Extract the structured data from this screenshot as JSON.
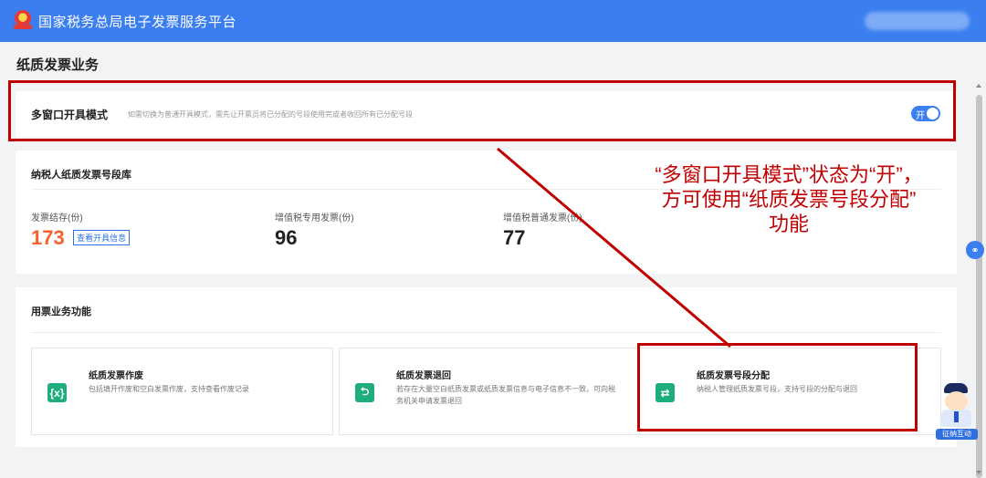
{
  "header": {
    "platform_name": "国家税务总局电子发票服务平台",
    "emblem_icon": "tax-emblem-icon",
    "brand_color": "#3a7ef0"
  },
  "page": {
    "title": "纸质发票业务"
  },
  "multi_window": {
    "title": "多窗口开具模式",
    "hint": "如需切换为普通开具模式，需先让开票员将已分配的号段使用完或者收回所有已分配号段",
    "toggle_label": "开",
    "toggle_on": true
  },
  "invoice_pool": {
    "title": "纳税人纸质发票号段库",
    "stats": [
      {
        "label": "发票结存(份)",
        "value": "173",
        "link": "查看开具信息"
      },
      {
        "label": "增值税专用发票(份)",
        "value": "96"
      },
      {
        "label": "增值税普通发票(份)",
        "value": "77"
      }
    ]
  },
  "functions": {
    "title": "用票业务功能",
    "tiles": [
      {
        "icon": "void-invoice-icon",
        "glyph": "{x}",
        "name": "纸质发票作废",
        "desc": "包括填开作废和空白发票作废，支持查看作废记录"
      },
      {
        "icon": "return-invoice-icon",
        "glyph": "⮌",
        "name": "纸质发票退回",
        "desc": "若存在大量空白纸质发票或纸质发票信息与电子信息不一致，可向税务机关申请发票退回"
      },
      {
        "icon": "allocate-segment-icon",
        "glyph": "⇄",
        "name": "纸质发票号段分配",
        "desc": "纳税人管理纸质发票号段，支持号段的分配与退回"
      }
    ]
  },
  "annotation": {
    "text": "“多窗口开具模式”状态为“开”，\n方可使用“纸质发票号段分配”\n功能",
    "color": "#c00000"
  },
  "assistant": {
    "badge": "征纳互动",
    "helper_icon": "headset-icon"
  }
}
